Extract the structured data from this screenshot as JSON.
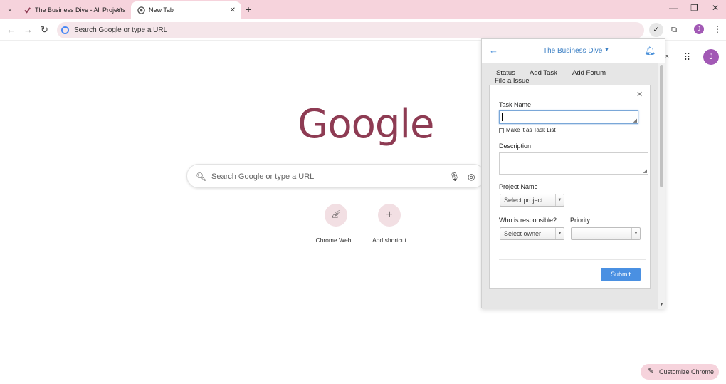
{
  "browser": {
    "tabs": [
      {
        "title": "The Business Dive - All Projects",
        "active": false
      },
      {
        "title": "New Tab",
        "active": true
      }
    ],
    "omnibox_text": "Search Google or type a URL",
    "profile_initial": "J",
    "accent_color": "#f6d3dc"
  },
  "newtab": {
    "logo_text": "Google",
    "search_placeholder": "Search Google or type a URL",
    "shortcuts": [
      {
        "label": "Chrome Web...",
        "icon": "chrome-web-store-icon"
      },
      {
        "label": "Add shortcut",
        "icon": "plus-icon"
      }
    ],
    "partial_link": "es",
    "customize_label": "Customize Chrome",
    "avatar_initial": "J"
  },
  "popup": {
    "project_title": "The Business Dive",
    "tabs": [
      "Status",
      "Add Task",
      "Add Forum",
      "File a Issue"
    ],
    "active_tab": "Add Task",
    "form": {
      "task_name_label": "Task Name",
      "task_name_value": "",
      "task_list_checkbox_label": "Make it as Task List",
      "description_label": "Description",
      "project_name_label": "Project Name",
      "project_select_value": "Select project",
      "responsible_label": "Who is responsible?",
      "owner_select_value": "Select owner",
      "priority_label": "Priority",
      "priority_select_value": "",
      "submit_label": "Submit"
    },
    "link_color": "#3b7fc4",
    "button_color": "#4a90e2"
  }
}
